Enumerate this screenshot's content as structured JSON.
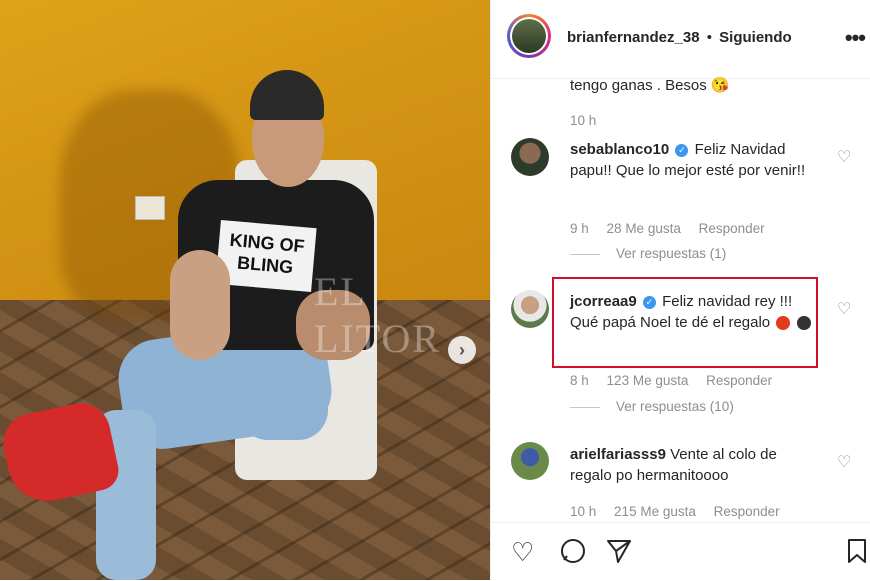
{
  "header": {
    "username": "brianfernandez_38",
    "separator": "•",
    "follow_status": "Siguiendo",
    "more_icon": "more-dots-icon"
  },
  "photo": {
    "shirt_text_line1": "KING OF",
    "shirt_text_line2": "BLING",
    "watermark": "EL LITOR"
  },
  "prev_comment": {
    "text": "tengo ganas . Besos 😘",
    "time": "10 h"
  },
  "comments": [
    {
      "username": "sebablanco10",
      "text": "Feliz Navidad papu!! Que lo mejor esté por venir!!",
      "time": "9 h",
      "likes": "28 Me gusta",
      "reply": "Responder",
      "view_replies": "Ver respuestas (1)"
    },
    {
      "username": "jcorreaa9",
      "text": "Feliz navidad rey !!! Qué papá Noel te dé el regalo",
      "time": "8 h",
      "likes": "123 Me gusta",
      "reply": "Responder",
      "view_replies": "Ver respuestas (10)"
    },
    {
      "username": "arielfariasss9",
      "text": "Vente al colo de regalo po hermanitoooo",
      "time": "10 h",
      "likes": "215 Me gusta",
      "reply": "Responder"
    }
  ],
  "colors": {
    "highlight_box": "#d0102a",
    "verified": "#3897f0",
    "meta": "#8e8e8e"
  }
}
